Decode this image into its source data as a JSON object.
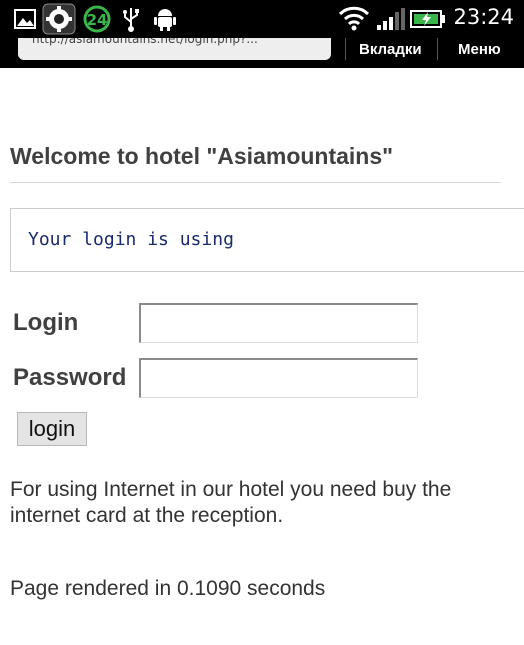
{
  "status_bar": {
    "time": "23:24",
    "notification_badge": "24",
    "icons": [
      "image-icon",
      "app-icon",
      "badge-24-icon",
      "usb-icon",
      "android-debug-icon",
      "wifi-icon",
      "signal-icon",
      "battery-charging-icon"
    ]
  },
  "browser": {
    "url_text": "http://asiamountains.net/login.php?...",
    "tabs_label": "Вкладки",
    "menu_label": "Меню"
  },
  "page": {
    "title": "Welcome to hotel \"Asiamountains\"",
    "notice": "Your login is using",
    "login_label": "Login",
    "login_value": "",
    "password_label": "Password",
    "password_value": "",
    "login_button": "login",
    "info_text": "For using Internet in our hotel you need buy the internet card at the reception.",
    "render_time": "Page rendered in 0.1090 seconds"
  },
  "colors": {
    "heading": "#404040",
    "notice_text": "#1a2a6c",
    "status_bar_bg": "#000000",
    "badge_green": "#39b54a"
  }
}
